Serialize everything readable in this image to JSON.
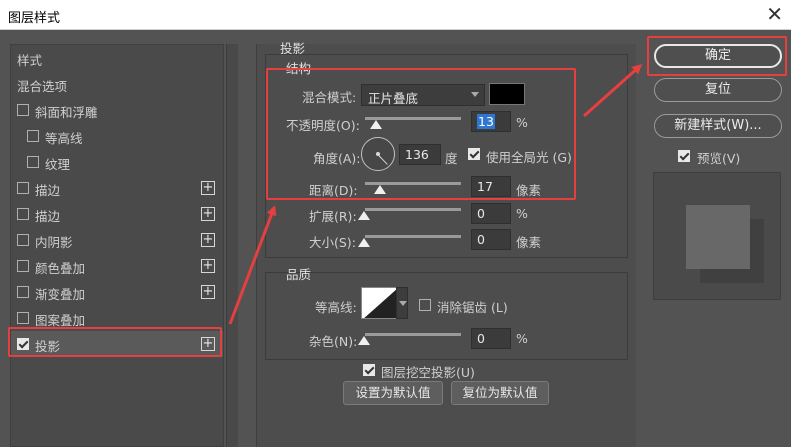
{
  "window": {
    "title": "图层样式",
    "close_glyph": "✕"
  },
  "styles_list": [
    {
      "label": "样式",
      "has_checkbox": false,
      "checked": false,
      "has_plus": false,
      "indent": false,
      "active": false
    },
    {
      "label": "混合选项",
      "has_checkbox": false,
      "checked": false,
      "has_plus": false,
      "indent": false,
      "active": false
    },
    {
      "label": "斜面和浮雕",
      "has_checkbox": true,
      "checked": false,
      "has_plus": false,
      "indent": false,
      "active": false
    },
    {
      "label": "等高线",
      "has_checkbox": true,
      "checked": false,
      "has_plus": false,
      "indent": true,
      "active": false
    },
    {
      "label": "纹理",
      "has_checkbox": true,
      "checked": false,
      "has_plus": false,
      "indent": true,
      "active": false
    },
    {
      "label": "描边",
      "has_checkbox": true,
      "checked": false,
      "has_plus": true,
      "indent": false,
      "active": false
    },
    {
      "label": "描边",
      "has_checkbox": true,
      "checked": false,
      "has_plus": true,
      "indent": false,
      "active": false
    },
    {
      "label": "内阴影",
      "has_checkbox": true,
      "checked": false,
      "has_plus": true,
      "indent": false,
      "active": false
    },
    {
      "label": "颜色叠加",
      "has_checkbox": true,
      "checked": false,
      "has_plus": true,
      "indent": false,
      "active": false
    },
    {
      "label": "渐变叠加",
      "has_checkbox": true,
      "checked": false,
      "has_plus": true,
      "indent": false,
      "active": false
    },
    {
      "label": "图案叠加",
      "has_checkbox": true,
      "checked": false,
      "has_plus": false,
      "indent": false,
      "active": false
    },
    {
      "label": "投影",
      "has_checkbox": true,
      "checked": true,
      "has_plus": true,
      "indent": false,
      "active": true
    }
  ],
  "drop_shadow": {
    "section_title": "投影",
    "structure": {
      "title": "结构",
      "blend_mode_label": "混合模式:",
      "blend_mode_value": "正片叠底",
      "shadow_color": "#000000",
      "opacity_label": "不透明度(O):",
      "opacity_value": "13",
      "opacity_unit": "%",
      "angle_label": "角度(A):",
      "angle_value": "136",
      "angle_unit": "度",
      "global_light_label": "使用全局光 (G)",
      "global_light_checked": true,
      "distance_label": "距离(D):",
      "distance_value": "17",
      "distance_unit": "像素",
      "spread_label": "扩展(R):",
      "spread_value": "0",
      "spread_unit": "%",
      "size_label": "大小(S):",
      "size_value": "0",
      "size_unit": "像素"
    },
    "quality": {
      "title": "品质",
      "contour_label": "等高线:",
      "anti_alias_label": "消除锯齿 (L)",
      "anti_alias_checked": false,
      "noise_label": "杂色(N):",
      "noise_value": "0",
      "noise_unit": "%"
    },
    "knockout_label": "图层挖空投影(U)",
    "knockout_checked": true,
    "set_default_label": "设置为默认值",
    "reset_default_label": "复位为默认值"
  },
  "actions": {
    "ok_label": "确定",
    "reset_label": "复位",
    "new_style_label": "新建样式(W)...",
    "preview_label": "预览(V)",
    "preview_checked": true
  },
  "colors": {
    "highlight": "#e5403f",
    "dialog_bg": "#535353",
    "selection_blue": "#2f76d1"
  }
}
